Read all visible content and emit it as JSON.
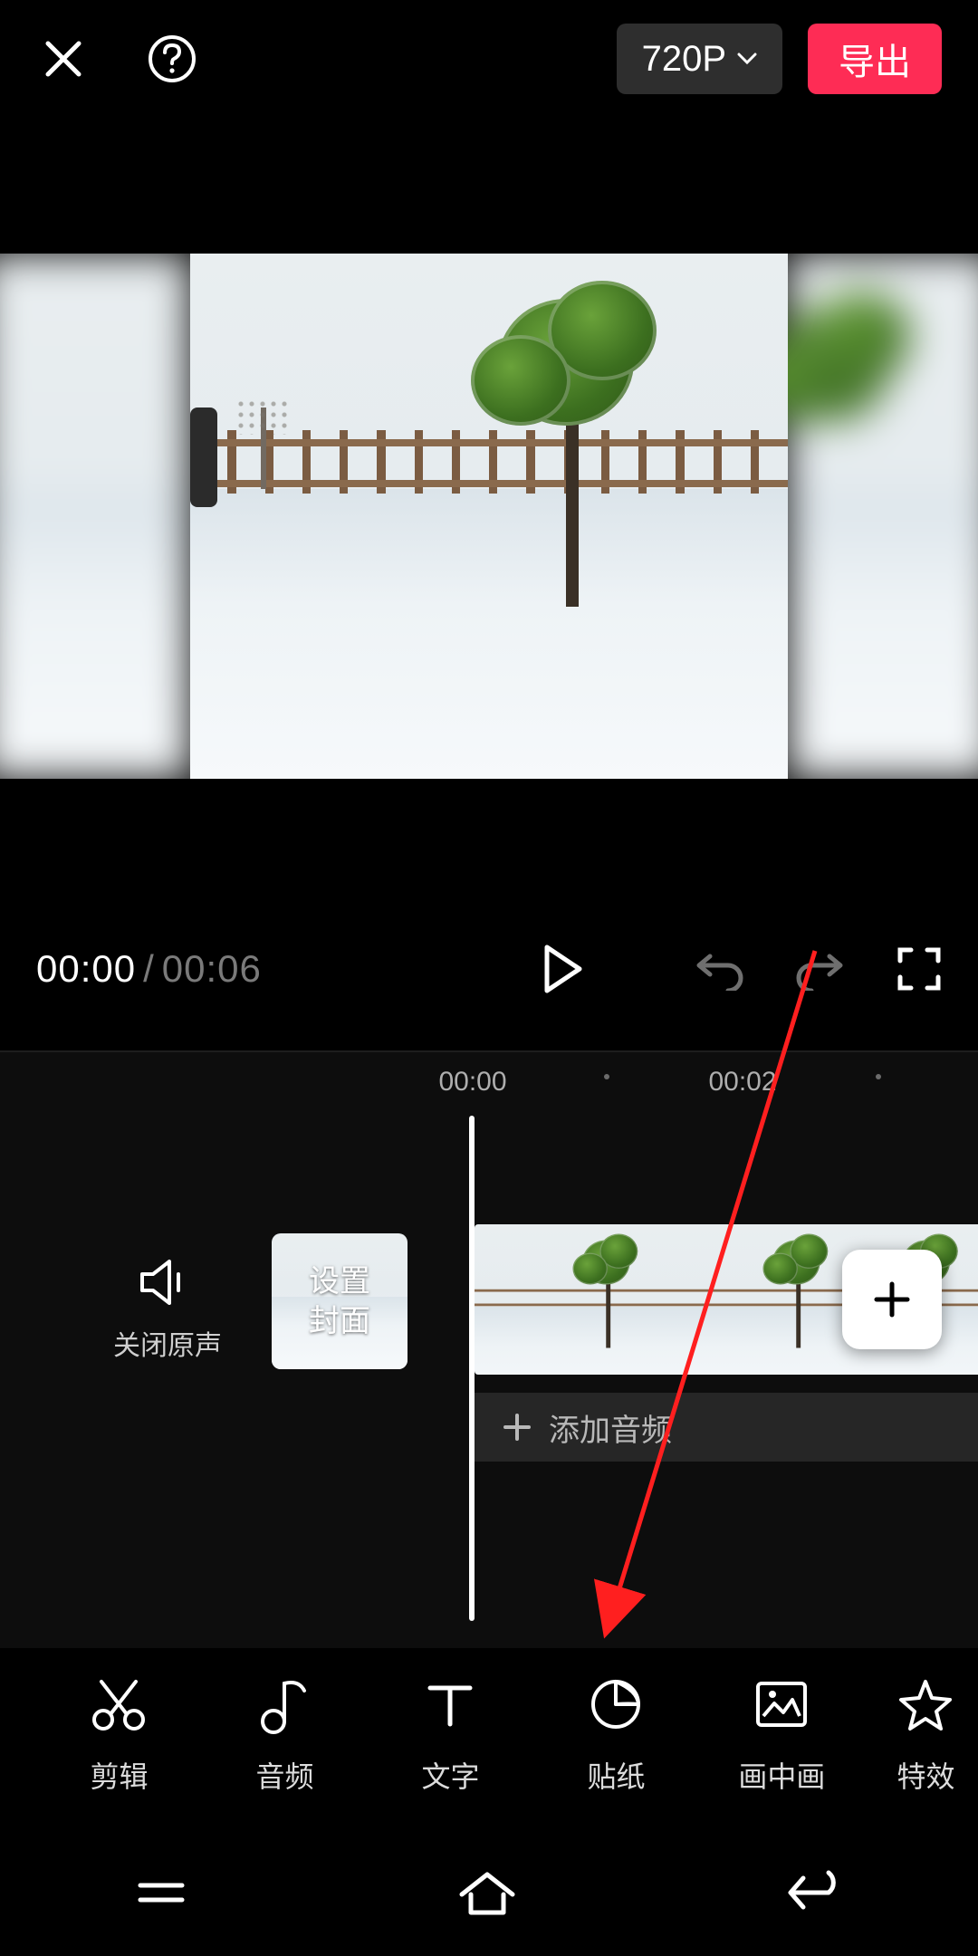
{
  "topbar": {
    "resolution_label": "720P",
    "export_label": "导出"
  },
  "playback": {
    "current_time": "00:00",
    "total_time": "00:06"
  },
  "ruler": {
    "ticks": [
      "00:00",
      "00:02"
    ]
  },
  "mute": {
    "label": "关闭原声"
  },
  "cover": {
    "label_line1": "设置",
    "label_line2": "封面"
  },
  "audio_track": {
    "label": "添加音频"
  },
  "tools": [
    {
      "icon": "scissors",
      "label": "剪辑"
    },
    {
      "icon": "music-note",
      "label": "音频"
    },
    {
      "icon": "text",
      "label": "文字"
    },
    {
      "icon": "sticker",
      "label": "贴纸"
    },
    {
      "icon": "pip",
      "label": "画中画"
    },
    {
      "icon": "star",
      "label": "特效"
    }
  ],
  "colors": {
    "accent": "#fe2c55"
  }
}
